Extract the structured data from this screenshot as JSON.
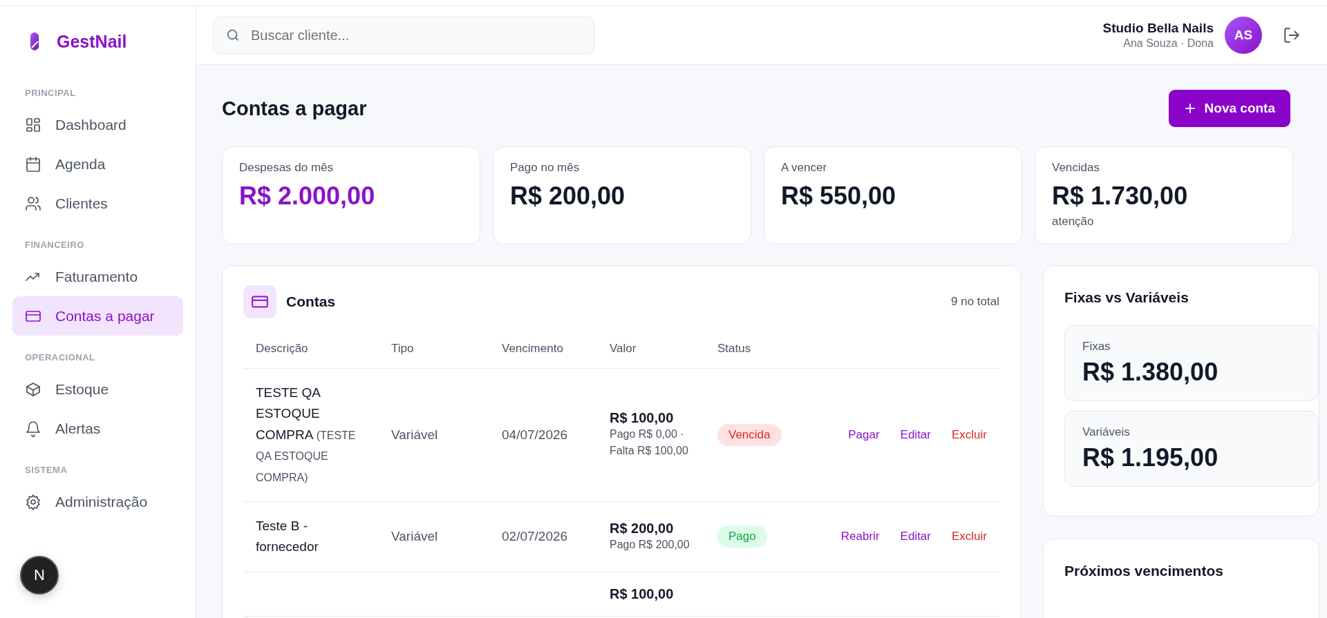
{
  "brand": {
    "name": "GestNail"
  },
  "sidebar": {
    "sections": [
      {
        "title": "PRINCIPAL",
        "items": [
          {
            "label": "Dashboard",
            "selected": false
          },
          {
            "label": "Agenda",
            "selected": false
          },
          {
            "label": "Clientes",
            "selected": false
          }
        ]
      },
      {
        "title": "FINANCEIRO",
        "items": [
          {
            "label": "Faturamento",
            "selected": false
          },
          {
            "label": "Contas a pagar",
            "selected": true
          }
        ]
      },
      {
        "title": "OPERACIONAL",
        "items": [
          {
            "label": "Estoque",
            "selected": false
          },
          {
            "label": "Alertas",
            "selected": false
          }
        ]
      },
      {
        "title": "SISTEMA",
        "items": [
          {
            "label": "Administração",
            "selected": false
          }
        ]
      }
    ],
    "floating_badge": "N"
  },
  "header": {
    "search": {
      "placeholder": "Buscar cliente..."
    },
    "business": "Studio Bella Nails",
    "user": "Ana Souza · Dona",
    "avatar": "AS"
  },
  "page": {
    "title": "Contas a pagar",
    "new_button": "Nova conta"
  },
  "stats": [
    {
      "label": "Despesas do mês",
      "value": "R$ 2.000,00",
      "highlight": true
    },
    {
      "label": "Pago no mês",
      "value": "R$ 200,00",
      "highlight": false
    },
    {
      "label": "A vencer",
      "value": "R$ 550,00",
      "highlight": false
    },
    {
      "label": "Vencidas",
      "value": "R$ 1.730,00",
      "highlight": false,
      "note": "atenção"
    }
  ],
  "table": {
    "title": "Contas",
    "count": "9 no total",
    "columns": [
      "Descrição",
      "Tipo",
      "Vencimento",
      "Valor",
      "Status"
    ],
    "rows": [
      {
        "name": "TESTE QA ESTOQUE COMPRA",
        "note": "(TESTE QA ESTOQUE COMPRA)",
        "type": "Variável",
        "due": "04/07/2026",
        "amount": "R$ 100,00",
        "detail": "Pago R$ 0,00 · Falta R$ 100,00",
        "status": {
          "label": "Vencida",
          "kind": "overdue"
        },
        "actions": [
          {
            "label": "Pagar",
            "kind": "primary"
          },
          {
            "label": "Editar",
            "kind": "primary"
          },
          {
            "label": "Excluir",
            "kind": "danger"
          }
        ]
      },
      {
        "name": "Teste B - fornecedor",
        "type": "Variável",
        "due": "02/07/2026",
        "amount": "R$ 200,00",
        "detail": "Pago R$ 200,00",
        "status": {
          "label": "Pago",
          "kind": "paid"
        },
        "actions": [
          {
            "label": "Reabrir",
            "kind": "primary"
          },
          {
            "label": "Editar",
            "kind": "primary"
          },
          {
            "label": "Excluir",
            "kind": "danger"
          }
        ]
      },
      {
        "amount": "R$ 100,00"
      }
    ]
  },
  "split": {
    "title": "Fixas vs Variáveis",
    "items": [
      {
        "label": "Fixas",
        "value": "R$ 1.380,00"
      },
      {
        "label": "Variáveis",
        "value": "R$ 1.195,00"
      }
    ]
  },
  "upcoming": {
    "title": "Próximos vencimentos"
  }
}
